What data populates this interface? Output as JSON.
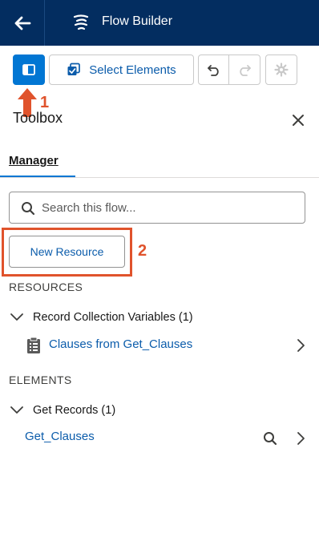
{
  "header": {
    "title": "Flow Builder",
    "back_icon": "arrow-left-icon",
    "logo_icon": "flow-logo-icon",
    "background": "#032d60"
  },
  "toolbar": {
    "toggle_icon": "panel-toggle-icon",
    "select_elements_label": "Select Elements",
    "undo_icon": "undo-icon",
    "redo_icon": "redo-icon",
    "settings_icon": "gear-icon",
    "accent": "#0176d3"
  },
  "annotations": {
    "marker_1": "1",
    "marker_2": "2",
    "color": "#e0532c"
  },
  "toolbox": {
    "title": "Toolbox",
    "close_icon": "close-icon",
    "tabs": [
      {
        "label": "Manager",
        "active": true
      }
    ],
    "search_placeholder": "Search this flow...",
    "new_resource_label": "New Resource",
    "resources": {
      "heading": "RESOURCES",
      "groups": [
        {
          "label": "Record Collection Variables (1)",
          "expanded": true,
          "items": [
            {
              "label": "Clauses from Get_Clauses",
              "icon": "clipboard-icon"
            }
          ]
        }
      ]
    },
    "elements": {
      "heading": "ELEMENTS",
      "groups": [
        {
          "label": "Get Records (1)",
          "expanded": true,
          "items": [
            {
              "label": "Get_Clauses",
              "icon": "search-icon"
            }
          ]
        }
      ]
    }
  }
}
